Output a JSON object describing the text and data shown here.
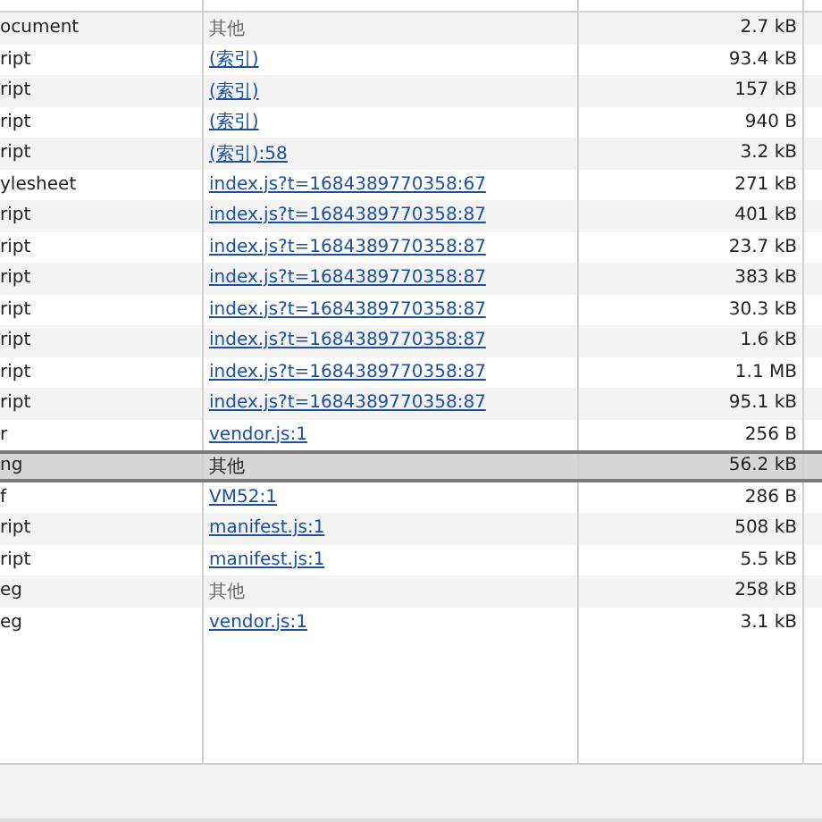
{
  "rows": [
    {
      "type": "ocument",
      "initiator": {
        "text": "其他",
        "kind": "plain"
      },
      "size": "2.7 kB",
      "selected": false
    },
    {
      "type": "ript",
      "initiator": {
        "text": "(索引)",
        "kind": "link"
      },
      "size": "93.4 kB",
      "selected": false
    },
    {
      "type": "ript",
      "initiator": {
        "text": "(索引)",
        "kind": "link"
      },
      "size": "157 kB",
      "selected": false
    },
    {
      "type": "ript",
      "initiator": {
        "text": "(索引)",
        "kind": "link"
      },
      "size": "940 B",
      "selected": false
    },
    {
      "type": "ript",
      "initiator": {
        "text": "(索引):58",
        "kind": "link"
      },
      "size": "3.2 kB",
      "selected": false
    },
    {
      "type": "ylesheet",
      "initiator": {
        "text": "index.js?t=1684389770358:67",
        "kind": "link"
      },
      "size": "271 kB",
      "selected": false
    },
    {
      "type": "ript",
      "initiator": {
        "text": "index.js?t=1684389770358:87",
        "kind": "link"
      },
      "size": "401 kB",
      "selected": false
    },
    {
      "type": "ript",
      "initiator": {
        "text": "index.js?t=1684389770358:87",
        "kind": "link"
      },
      "size": "23.7 kB",
      "selected": false
    },
    {
      "type": "ript",
      "initiator": {
        "text": "index.js?t=1684389770358:87",
        "kind": "link"
      },
      "size": "383 kB",
      "selected": false
    },
    {
      "type": "ript",
      "initiator": {
        "text": "index.js?t=1684389770358:87",
        "kind": "link"
      },
      "size": "30.3 kB",
      "selected": false
    },
    {
      "type": "ript",
      "initiator": {
        "text": "index.js?t=1684389770358:87",
        "kind": "link"
      },
      "size": "1.6 kB",
      "selected": false
    },
    {
      "type": "ript",
      "initiator": {
        "text": "index.js?t=1684389770358:87",
        "kind": "link"
      },
      "size": "1.1 MB",
      "selected": false
    },
    {
      "type": "ript",
      "initiator": {
        "text": "index.js?t=1684389770358:87",
        "kind": "link"
      },
      "size": "95.1 kB",
      "selected": false
    },
    {
      "type": "r",
      "initiator": {
        "text": "vendor.js:1",
        "kind": "link"
      },
      "size": "256 B",
      "selected": false
    },
    {
      "type": "ng",
      "initiator": {
        "text": "其他",
        "kind": "plain"
      },
      "size": "56.2 kB",
      "selected": true
    },
    {
      "type": "f",
      "initiator": {
        "text": "VM52:1",
        "kind": "link"
      },
      "size": "286 B",
      "selected": false
    },
    {
      "type": "ript",
      "initiator": {
        "text": "manifest.js:1",
        "kind": "link"
      },
      "size": "508 kB",
      "selected": false
    },
    {
      "type": "ript",
      "initiator": {
        "text": "manifest.js:1",
        "kind": "link"
      },
      "size": "5.5 kB",
      "selected": false
    },
    {
      "type": "eg",
      "initiator": {
        "text": "其他",
        "kind": "plain"
      },
      "size": "258 kB",
      "selected": false
    },
    {
      "type": "eg",
      "initiator": {
        "text": "vendor.js:1",
        "kind": "link"
      },
      "size": "3.1 kB",
      "selected": false
    }
  ]
}
